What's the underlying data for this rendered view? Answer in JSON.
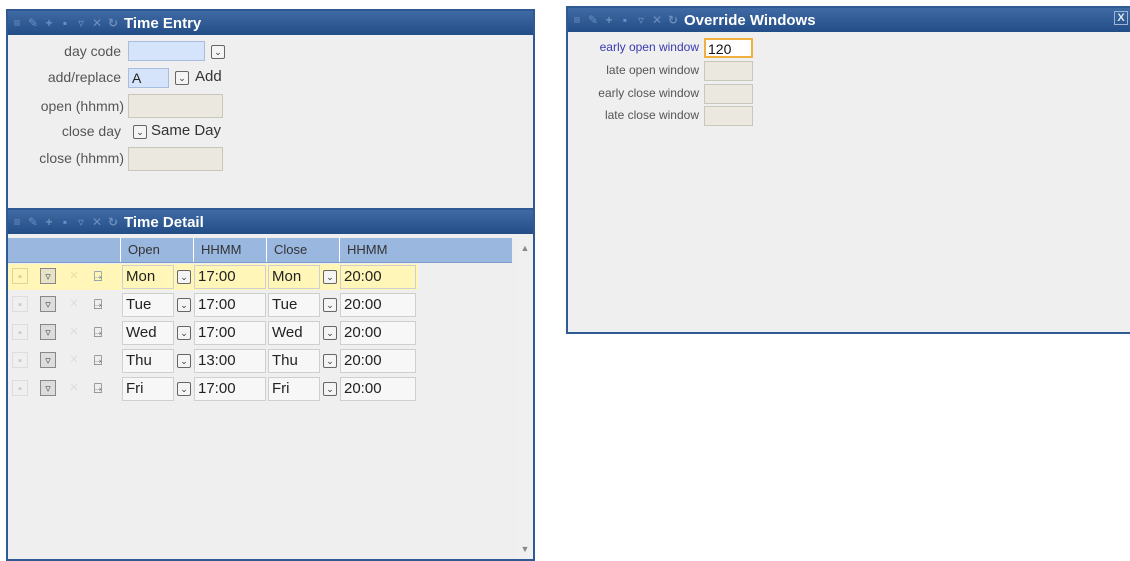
{
  "time_entry": {
    "title": "Time Entry",
    "day_code_label": "day code",
    "day_code_value": "",
    "add_replace_label": "add/replace",
    "add_replace_value": "A",
    "add_replace_text": "Add",
    "open_label": "open (hhmm)",
    "open_value": "",
    "close_day_label": "close day",
    "close_day_text": "Same Day",
    "close_label": "close (hhmm)",
    "close_value": ""
  },
  "time_detail": {
    "title": "Time Detail",
    "columns": [
      "Open",
      "HHMM",
      "Close",
      "HHMM"
    ],
    "rows": [
      {
        "open_day": "Mon",
        "open_time": "17:00",
        "close_day": "Mon",
        "close_time": "20:00"
      },
      {
        "open_day": "Tue",
        "open_time": "17:00",
        "close_day": "Tue",
        "close_time": "20:00"
      },
      {
        "open_day": "Wed",
        "open_time": "17:00",
        "close_day": "Wed",
        "close_time": "20:00"
      },
      {
        "open_day": "Thu",
        "open_time": "13:00",
        "close_day": "Thu",
        "close_time": "20:00"
      },
      {
        "open_day": "Fri",
        "open_time": "17:00",
        "close_day": "Fri",
        "close_time": "20:00"
      }
    ]
  },
  "override_windows": {
    "title": "Override Windows",
    "close_icon": "X",
    "fields": [
      {
        "label": "early open window",
        "value": "120"
      },
      {
        "label": "late open window",
        "value": ""
      },
      {
        "label": "early close window",
        "value": ""
      },
      {
        "label": "late close window",
        "value": ""
      }
    ]
  }
}
